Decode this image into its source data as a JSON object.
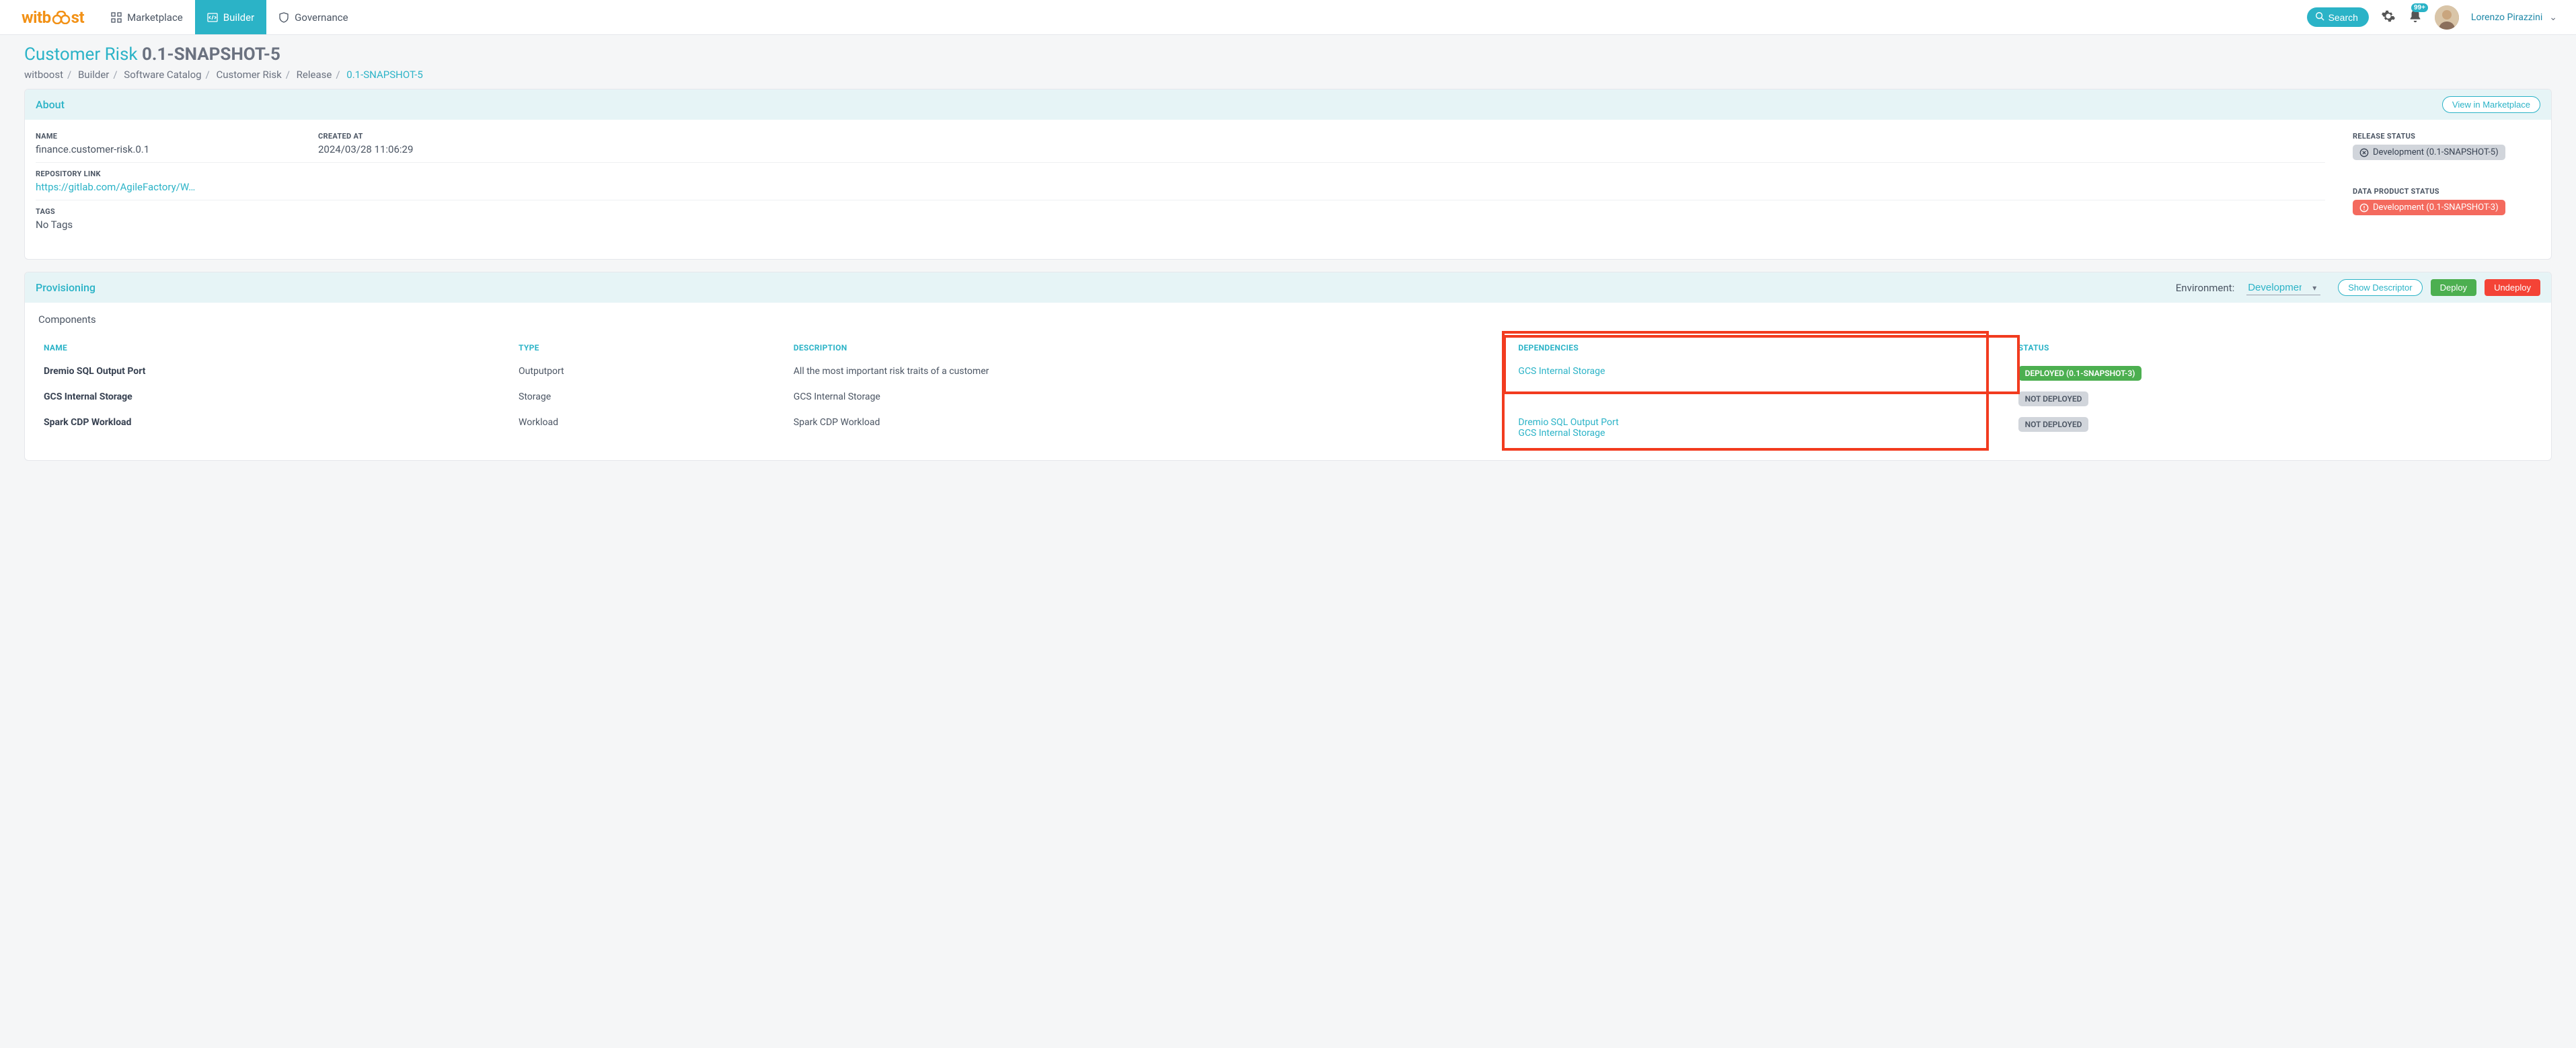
{
  "header": {
    "logo_text": "witboost",
    "nav": {
      "marketplace": "Marketplace",
      "builder": "Builder",
      "governance": "Governance"
    },
    "search_label": "Search",
    "notification_badge": "99+",
    "user_name": "Lorenzo Pirazzini"
  },
  "page": {
    "title_prefix": "Customer Risk ",
    "title_version": "0.1-SNAPSHOT-5",
    "breadcrumb": {
      "items": [
        "witboost",
        "Builder",
        "Software Catalog",
        "Customer Risk",
        "Release"
      ],
      "current": "0.1-SNAPSHOT-5"
    }
  },
  "about": {
    "card_title": "About",
    "view_marketplace_label": "View in Marketplace",
    "name_label": "NAME",
    "name_value": "finance.customer-risk.0.1",
    "created_label": "CREATED AT",
    "created_value": "2024/03/28 11:06:29",
    "repo_label": "REPOSITORY LINK",
    "repo_value": "https://gitlab.com/AgileFactory/W…",
    "tags_label": "TAGS",
    "tags_value": "No Tags",
    "release_status_label": "RELEASE STATUS",
    "release_status_value": "Development (0.1-SNAPSHOT-5)",
    "dp_status_label": "DATA PRODUCT STATUS",
    "dp_status_value": "Development (0.1-SNAPSHOT-3)"
  },
  "provisioning": {
    "card_title": "Provisioning",
    "env_label": "Environment:",
    "env_value": "Development",
    "show_descriptor_label": "Show Descriptor",
    "deploy_label": "Deploy",
    "undeploy_label": "Undeploy",
    "components_label": "Components",
    "columns": {
      "name": "NAME",
      "type": "TYPE",
      "description": "DESCRIPTION",
      "dependencies": "DEPENDENCIES",
      "status": "STATUS"
    },
    "rows": [
      {
        "name": "Dremio SQL Output Port",
        "type": "Outputport",
        "description": "All the most important risk traits of a customer",
        "dependencies": [
          "GCS Internal Storage"
        ],
        "status": "DEPLOYED (0.1-SNAPSHOT-3)",
        "status_class": "deployed"
      },
      {
        "name": "GCS Internal Storage",
        "type": "Storage",
        "description": "GCS Internal Storage",
        "dependencies": [],
        "status": "NOT DEPLOYED",
        "status_class": "not"
      },
      {
        "name": "Spark CDP Workload",
        "type": "Workload",
        "description": "Spark CDP Workload",
        "dependencies": [
          "Dremio SQL Output Port",
          "GCS Internal Storage"
        ],
        "status": "NOT DEPLOYED",
        "status_class": "not"
      }
    ]
  }
}
